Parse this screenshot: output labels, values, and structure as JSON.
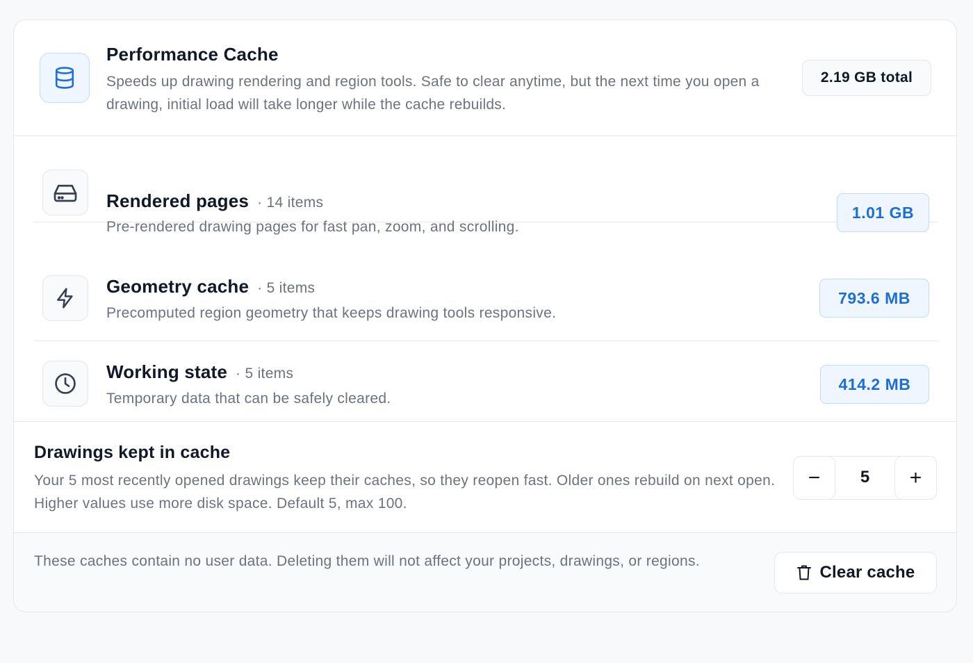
{
  "header": {
    "title": "Performance Cache",
    "description": "Speeds up drawing rendering and region tools. Safe to clear anytime, but the next time you open a drawing, initial load will take longer while the cache rebuilds.",
    "total": "2.19 GB total",
    "icon": "database-icon"
  },
  "items": [
    {
      "title": "Rendered pages",
      "count": "· 14 items",
      "description": "Pre-rendered drawing pages for fast pan, zoom, and scrolling.",
      "size": "1.01 GB",
      "icon": "hard-drive-icon"
    },
    {
      "title": "Geometry cache",
      "count": "· 5 items",
      "description": "Precomputed region geometry that keeps drawing tools responsive.",
      "size": "793.6 MB",
      "icon": "lightning-icon"
    },
    {
      "title": "Working state",
      "count": "· 5 items",
      "description": "Temporary data that can be safely cleared.",
      "size": "414.2 MB",
      "icon": "clock-icon"
    }
  ],
  "keep": {
    "title": "Drawings kept in cache",
    "description": "Your 5 most recently opened drawings keep their caches, so they reopen fast. Older ones rebuild on next open. Higher values use more disk space. Default 5, max 100.",
    "value": "5",
    "minus": "−",
    "plus": "+"
  },
  "footer": {
    "note": "These caches contain no user data. Deleting them will not affect your projects, drawings, or regions.",
    "clear_label": "Clear cache",
    "clear_icon": "trash-icon"
  },
  "colors": {
    "accent": "#1d6fd6",
    "accent_bg": "#eff6ff",
    "border": "#e5e7eb",
    "muted_text": "#6b7280"
  }
}
